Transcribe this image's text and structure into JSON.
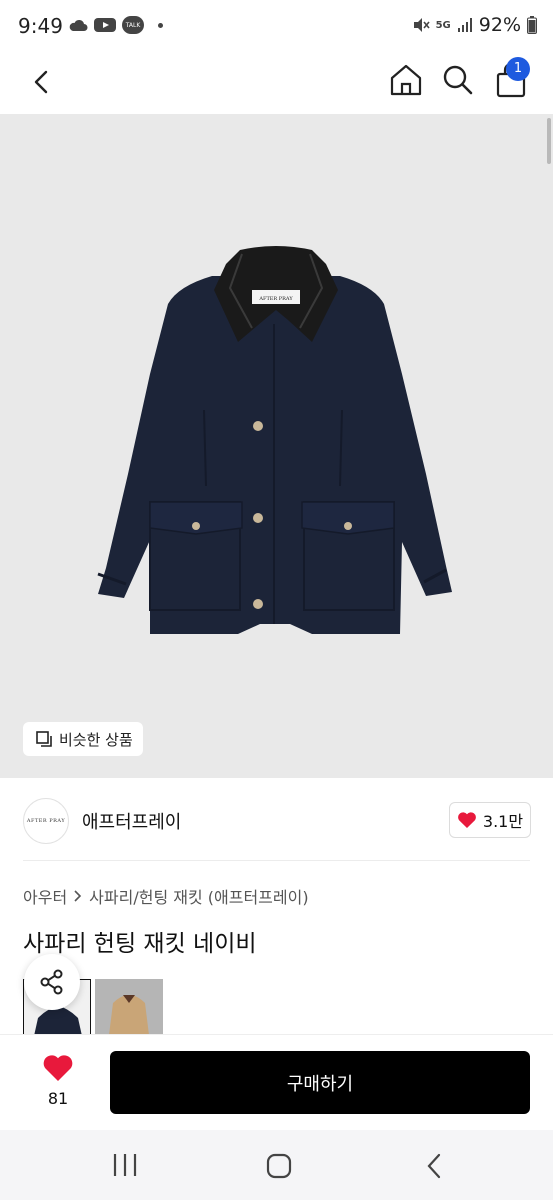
{
  "status_bar": {
    "time": "9:49",
    "talk_badge": "TALK",
    "network": "5G",
    "battery": "92%"
  },
  "header": {
    "cart_count": "1"
  },
  "image": {
    "jacket_label": "AFTER PRAY",
    "similar_label": "비슷한 상품"
  },
  "brand": {
    "logo_text": "AFTER PRAY",
    "name": "애프터프레이",
    "likes": "3.1만"
  },
  "breadcrumb": {
    "category": "아우터",
    "subcategory": "사파리/헌팅 재킷 (애프터프레이)"
  },
  "product": {
    "title": "사파리 헌팅 재킷 네이비"
  },
  "bottom": {
    "wish_count": "81",
    "buy_label": "구매하기"
  },
  "colors": {
    "accent": "#1e5adf",
    "heart": "#e8193c",
    "buy_button": "#000000",
    "jacket_navy": "#1c2438"
  }
}
